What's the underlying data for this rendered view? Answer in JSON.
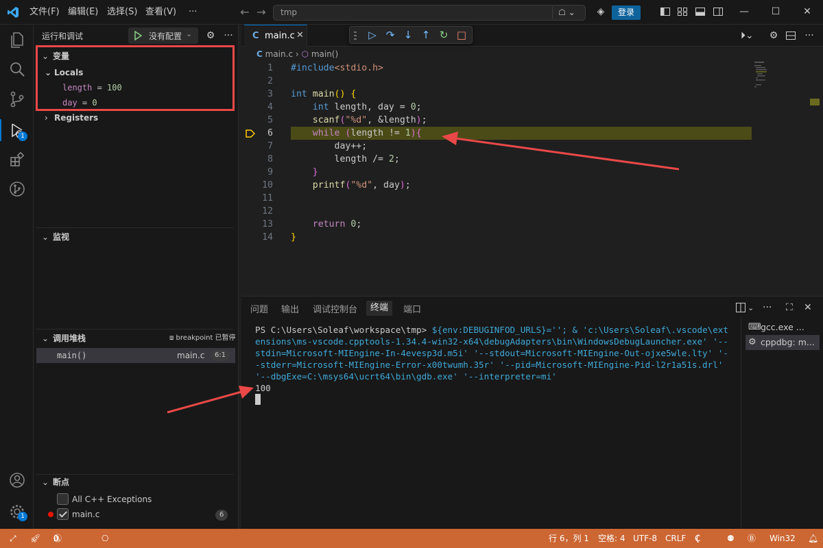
{
  "titlebar": {
    "menus": [
      "文件(F)",
      "编辑(E)",
      "选择(S)",
      "查看(V)",
      "···"
    ],
    "search": "tmp",
    "sign_in": "登录"
  },
  "sidebar": {
    "title": "运行和调试",
    "run_config": "没有配置",
    "variables": {
      "header": "变量",
      "scope": "Locals",
      "items": [
        {
          "name": "length",
          "value": "100"
        },
        {
          "name": "day",
          "value": "0"
        }
      ],
      "registers": "Registers"
    },
    "watch": {
      "header": "监视"
    },
    "callstack": {
      "header": "调用堆栈",
      "status": "breakpoint 已暂停",
      "frames": [
        {
          "name": "main()",
          "file": "main.c",
          "pos": "6:1"
        }
      ]
    },
    "breakpoints": {
      "header": "断点",
      "items": [
        {
          "label": "All C++ Exceptions",
          "checked": false
        },
        {
          "label": "main.c",
          "checked": true,
          "count": "6"
        }
      ]
    }
  },
  "activity_badges": {
    "debug": "1",
    "settings": "1"
  },
  "editor": {
    "tab": "main.c",
    "breadcrumb": {
      "file": "main.c",
      "symbol": "main()"
    },
    "current_line": 6
  },
  "panel": {
    "tabs": [
      "问题",
      "输出",
      "调试控制台",
      "终端",
      "端口"
    ],
    "active_tab": "终端",
    "terminal": {
      "prompt": "PS C:\\Users\\Soleaf\\workspace\\tmp> ",
      "command": "${env:DEBUGINFOD_URLS}=''; & 'c:\\Users\\Soleaf\\.vscode\\extensions\\ms-vscode.cpptools-1.34.4-win32-x64\\debugAdapters\\bin\\WindowsDebugLauncher.exe' '--stdin=Microsoft-MIEngine-In-4evesp3d.m5i' '--stdout=Microsoft-MIEngine-Out-ojxe5wle.lty' '--stderr=Microsoft-MIEngine-Error-x00twumh.35r' '--pid=Microsoft-MIEngine-Pid-l2r1a51s.drl' '--dbgExe=C:\\msys64\\ucrt64\\bin\\gdb.exe' '--interpreter=mi'",
      "output": "100"
    },
    "terminals": [
      {
        "label": "gcc.exe ...",
        "icon": "terminal-icon"
      },
      {
        "label": "cppdbg: m...",
        "icon": "debug-icon"
      }
    ]
  },
  "statusbar": {
    "problems_errors": "0",
    "problems_warnings": "0",
    "position": "行 6，列 1",
    "spaces": "空格: 4",
    "encoding": "UTF-8",
    "eol": "CRLF",
    "language": "C",
    "platform": "Win32"
  },
  "colors": {
    "accent": "#0078d4",
    "statusbar": "#cc6633",
    "current_line": "#4b4b18",
    "annotation": "#ea4848"
  }
}
